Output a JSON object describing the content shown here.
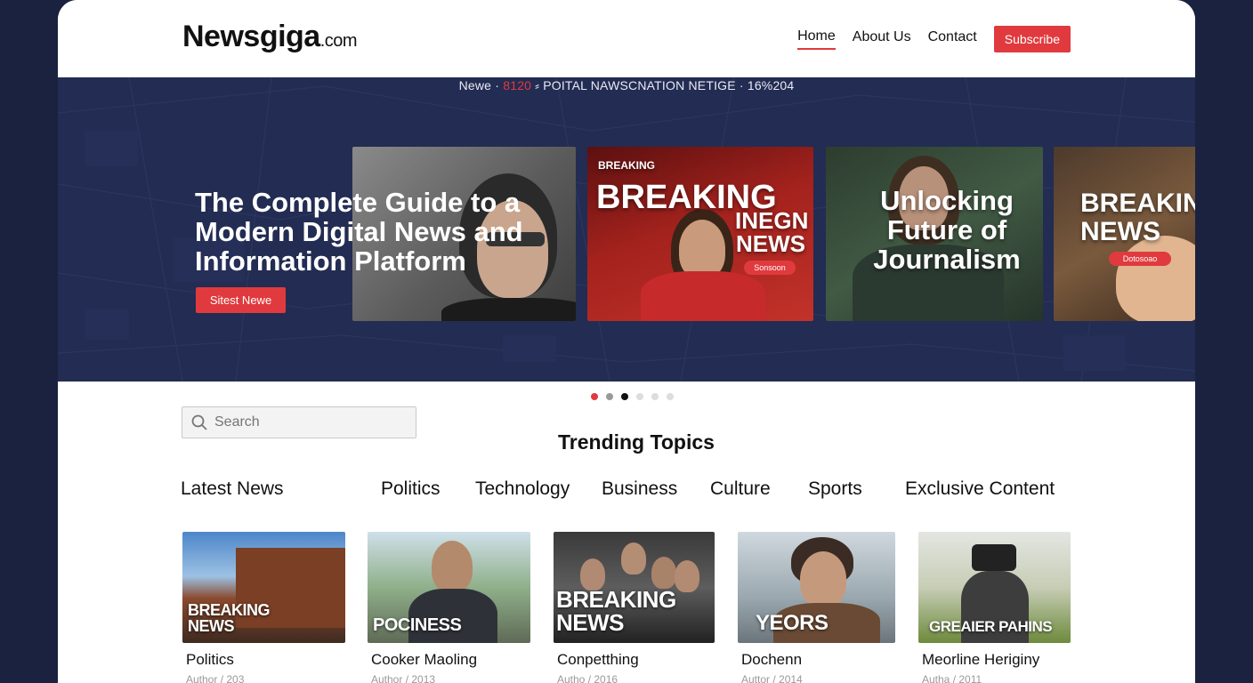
{
  "brand": {
    "name": "Newsgiga",
    "tld": ".com"
  },
  "nav": {
    "items": [
      {
        "label": "Home",
        "active": true
      },
      {
        "label": "About Us",
        "active": false
      },
      {
        "label": "Contact",
        "active": false
      }
    ],
    "subscribe_label": "Subscribe"
  },
  "hero": {
    "ticker": {
      "prefix": "Newe · ",
      "highlight": "8120",
      "suffix": " ⸗ POITAL NAWSCNATION NETIGE · 16%204"
    },
    "title": "The Complete Guide to a Modern Digital News and Information Platform",
    "cta_label": "Sitest Newe",
    "cards": [
      {
        "headline": ""
      },
      {
        "tag": "BREAKING",
        "headline": "BREAKING",
        "sub": "INEGN NEWS",
        "pill": "Sonsoon"
      },
      {
        "headline": "Unlocking Future of Journalism"
      },
      {
        "headline": "BREAKING NEWS",
        "pill": "Dotosoao"
      }
    ]
  },
  "carousel": {
    "count": 6,
    "active_index": 2
  },
  "search": {
    "placeholder": "Search"
  },
  "trending_title": "Trending Topics",
  "categories": [
    "Latest News",
    "Politics",
    "Technology",
    "Business",
    "Culture",
    "Sports",
    "Exclusive Content"
  ],
  "articles": [
    {
      "overlay": "BREAKING NEWS",
      "title": "Politics",
      "meta": "Author / 203"
    },
    {
      "overlay": "POCINESS",
      "title": "Cooker Maoling",
      "meta": "Author / 2013"
    },
    {
      "overlay": "BREAKING NEWS",
      "title": "Conpetthing",
      "meta": "Autho / 2016"
    },
    {
      "overlay": "YEORS",
      "title": "Dochenn",
      "meta": "Auttor / 2014"
    },
    {
      "overlay": "GREAIER PAHINS",
      "title": "Meorline Heriginy",
      "meta": "Autha / 2011"
    }
  ],
  "colors": {
    "accent": "#e03a3e",
    "hero_bg": "#232c52",
    "body_bg": "#1b2240"
  }
}
